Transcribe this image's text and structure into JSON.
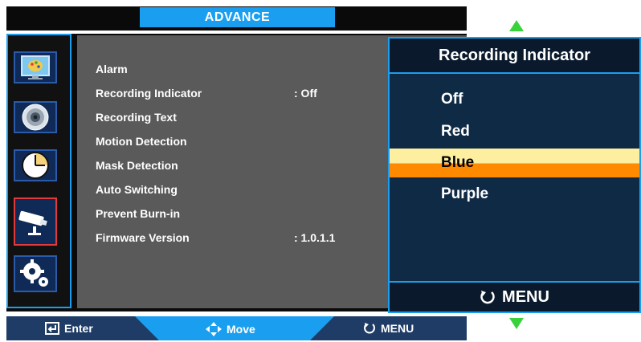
{
  "header": {
    "title": "ADVANCE"
  },
  "sidebar": {
    "items": [
      {
        "name": "picture",
        "icon": "monitor-palette-icon"
      },
      {
        "name": "audio",
        "icon": "speaker-icon"
      },
      {
        "name": "time",
        "icon": "clock-icon"
      },
      {
        "name": "advance",
        "icon": "camera-icon",
        "selected": true
      },
      {
        "name": "setup",
        "icon": "gears-icon"
      }
    ]
  },
  "menu": {
    "items": [
      {
        "label": "Alarm",
        "value": ""
      },
      {
        "label": "Recording Indicator",
        "value": ": Off"
      },
      {
        "label": "Recording Text",
        "value": ""
      },
      {
        "label": "Motion Detection",
        "value": ""
      },
      {
        "label": "Mask Detection",
        "value": ""
      },
      {
        "label": "Auto Switching",
        "value": ""
      },
      {
        "label": "Prevent Burn-in",
        "value": ""
      },
      {
        "label": "Firmware Version",
        "value": ": 1.0.1.1"
      }
    ]
  },
  "popup": {
    "title": "Recording Indicator",
    "options": [
      "Off",
      "Red",
      "Blue",
      "Purple"
    ],
    "selected_option": "Blue",
    "footer_label": "MENU"
  },
  "footer": {
    "enter_label": "Enter",
    "move_label": "Move",
    "menu_label": "MENU"
  },
  "colors": {
    "accent_blue": "#1a9ff0",
    "panel_gray": "#5a5a5a",
    "popup_bg": "#0f2a45",
    "highlight_yellow": "#fdeea0",
    "highlight_orange": "#ff8a00",
    "arrow_green": "#3ad23a"
  }
}
